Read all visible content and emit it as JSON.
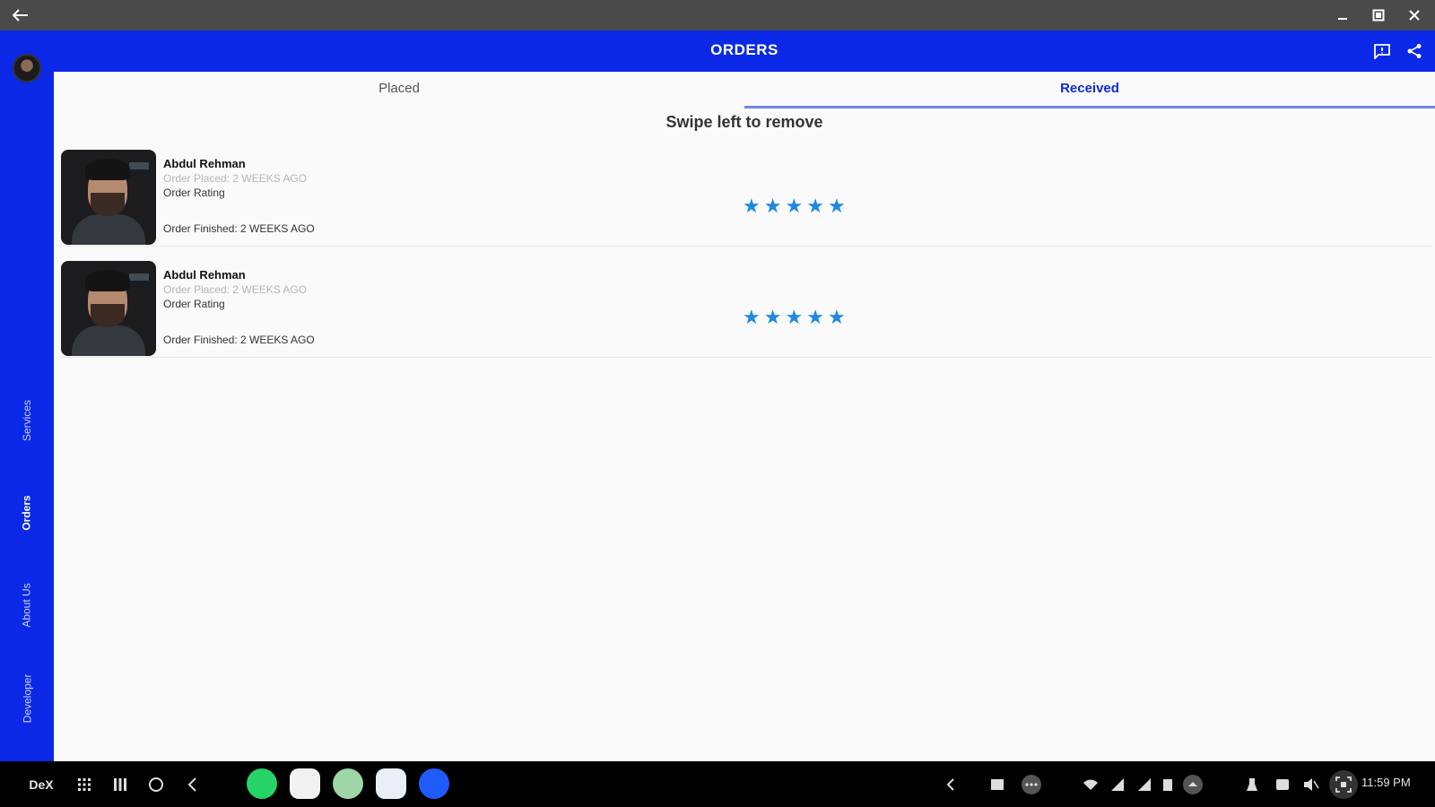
{
  "window": {
    "back_icon": "arrow-left-icon",
    "controls": [
      "minimize-icon",
      "restore-icon",
      "close-icon"
    ]
  },
  "appbar": {
    "title": "ORDERS",
    "icons": [
      "feedback-icon",
      "share-icon"
    ]
  },
  "sidebar": {
    "items": [
      {
        "label": "Services",
        "active": false
      },
      {
        "label": "Orders",
        "active": true
      },
      {
        "label": "About Us",
        "active": false
      },
      {
        "label": "Developer",
        "active": false
      }
    ]
  },
  "tabs": [
    {
      "label": "Placed",
      "selected": false
    },
    {
      "label": "Received",
      "selected": true
    }
  ],
  "hint": "Swipe left to remove",
  "orders": [
    {
      "name": "Abdul Rehman",
      "placed": "Order Placed: 2 WEEKS AGO",
      "rating_label": "Order Rating",
      "finished": "Order Finished: 2 WEEKS AGO",
      "rating": 5
    },
    {
      "name": "Abdul Rehman",
      "placed": "Order Placed: 2 WEEKS AGO",
      "rating_label": "Order Rating",
      "finished": "Order Finished: 2 WEEKS AGO",
      "rating": 5
    }
  ],
  "taskbar": {
    "dex_label": "DeX",
    "time": "11:59 PM",
    "apps": [
      "whatsapp-icon",
      "gallery-icon",
      "app-icon",
      "app-icon",
      "messenger-icon"
    ]
  },
  "colors": {
    "primary": "#0a28e6",
    "star": "#1e88e5",
    "background": "#fafafa"
  }
}
